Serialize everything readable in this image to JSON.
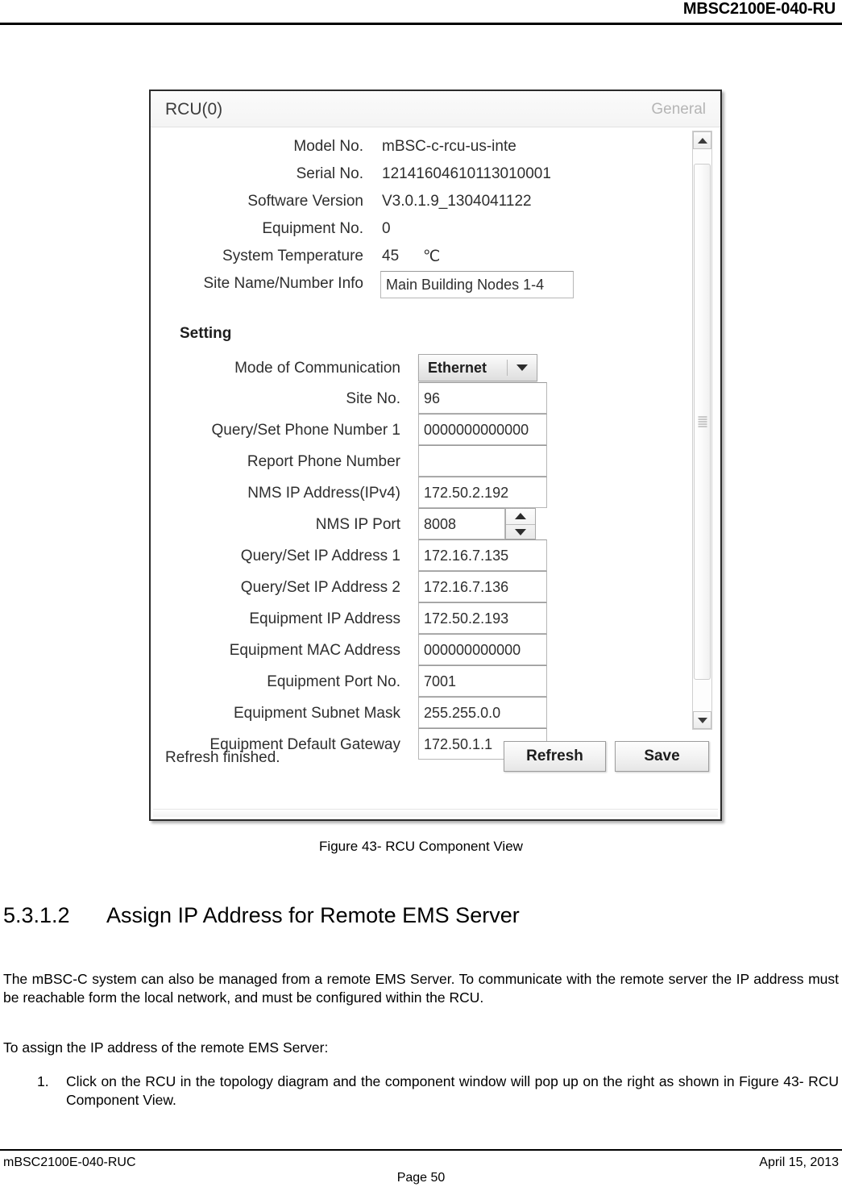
{
  "document": {
    "header_title": "MBSC2100E-040-RU",
    "figure_caption": "Figure 43- RCU Component View",
    "heading": {
      "number": "5.3.1.2",
      "text": "Assign IP Address for Remote EMS Server"
    },
    "paragraph_1": "The mBSC-C system can also be managed from a remote EMS Server. To communicate with the remote server the IP address must be reachable form the local network, and must be configured within the RCU.",
    "paragraph_2": "To assign the IP address of the remote EMS Server:",
    "list": [
      {
        "number": "1.",
        "text": "Click on the RCU in the topology diagram and the component window will pop up on the right as shown in Figure 43- RCU Component View."
      }
    ],
    "footer": {
      "left": "mBSC2100E-040-RUC",
      "right": "April 15, 2013",
      "center": "Page 50"
    }
  },
  "panel": {
    "title": "RCU(0)",
    "tab": "General",
    "info_fields": [
      {
        "label": "Model No.",
        "value": "mBSC-c-rcu-us-inte"
      },
      {
        "label": "Serial No.",
        "value": "12141604610113010001"
      },
      {
        "label": "Software Version",
        "value": "V3.0.1.9_1304041122"
      },
      {
        "label": "Equipment No.",
        "value": "0"
      },
      {
        "label": "System Temperature",
        "value": "45",
        "unit": "℃"
      },
      {
        "label": "Site Name/Number Info",
        "value": "Main Building Nodes 1-4"
      }
    ],
    "setting_heading": "Setting",
    "setting_fields": [
      {
        "label": "Mode of Communication",
        "value": "Ethernet",
        "type": "combo"
      },
      {
        "label": "Site No.",
        "value": "96",
        "type": "text"
      },
      {
        "label": "Query/Set Phone Number 1",
        "value": "0000000000000",
        "type": "text"
      },
      {
        "label": "Report Phone Number",
        "value": "",
        "type": "text"
      },
      {
        "label": "NMS IP Address(IPv4)",
        "value": "172.50.2.192",
        "type": "text"
      },
      {
        "label": "NMS IP Port",
        "value": "8008",
        "type": "spinner"
      },
      {
        "label": "Query/Set IP Address 1",
        "value": "172.16.7.135",
        "type": "text"
      },
      {
        "label": "Query/Set IP Address 2",
        "value": "172.16.7.136",
        "type": "text"
      },
      {
        "label": "Equipment IP Address",
        "value": "172.50.2.193",
        "type": "text"
      },
      {
        "label": "Equipment MAC Address",
        "value": "000000000000",
        "type": "text"
      },
      {
        "label": "Equipment Port No.",
        "value": "7001",
        "type": "text"
      },
      {
        "label": "Equipment Subnet Mask",
        "value": "255.255.0.0",
        "type": "text"
      },
      {
        "label": "Equipment Default Gateway",
        "value": "172.50.1.1",
        "type": "text"
      }
    ],
    "status": "Refresh finished.",
    "buttons": {
      "refresh": "Refresh",
      "save": "Save"
    }
  }
}
